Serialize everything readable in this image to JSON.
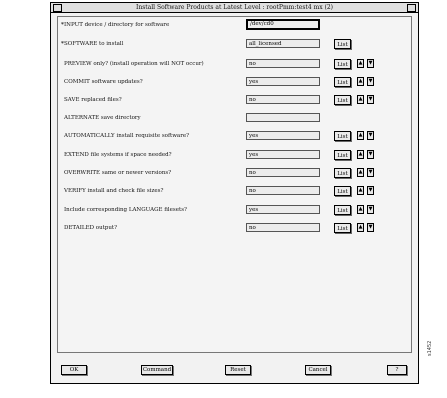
{
  "window": {
    "title": "Install Software Products at Latest Level : rootPmm:test4 mx (2)"
  },
  "rows": [
    {
      "label": "INPUT device / directory for software",
      "required": true,
      "value": "/dev/cd0",
      "focused": true,
      "list": false,
      "arrows": false
    },
    {
      "label": "SOFTWARE to install",
      "required": true,
      "value": "all_licensed",
      "list": true,
      "arrows": false
    },
    {
      "label": "PREVIEW only? (install operation will NOT occur)",
      "value": "no",
      "list": true,
      "arrows": true
    },
    {
      "label": "COMMIT software updates?",
      "value": "yes",
      "list": true,
      "arrows": true
    },
    {
      "label": "SAVE replaced files?",
      "value": "no",
      "list": true,
      "arrows": true
    },
    {
      "label": "ALTERNATE save directory",
      "value": "",
      "list": false,
      "arrows": false
    },
    {
      "label": "AUTOMATICALLY install requisite software?",
      "value": "yes",
      "list": true,
      "arrows": true
    },
    {
      "label": "EXTEND file systems if space needed?",
      "value": "yes",
      "list": true,
      "arrows": true
    },
    {
      "label": "OVERWRITE same or newer versions?",
      "value": "no",
      "list": true,
      "arrows": true
    },
    {
      "label": "VERIFY install and check file sizes?",
      "value": "no",
      "list": true,
      "arrows": true
    },
    {
      "label": "Include corresponding LANGUAGE filesets?",
      "value": "yes",
      "list": true,
      "arrows": true
    },
    {
      "label": "DETAILED output?",
      "value": "no",
      "list": true,
      "arrows": true
    }
  ],
  "list_label": "List",
  "icons": {
    "up": "arrow-up-icon",
    "down": "arrow-down-icon"
  },
  "buttons": {
    "ok": "OK",
    "command": "Command",
    "reset": "Reset",
    "cancel": "Cancel",
    "help": "?"
  },
  "side_label": "s1452"
}
